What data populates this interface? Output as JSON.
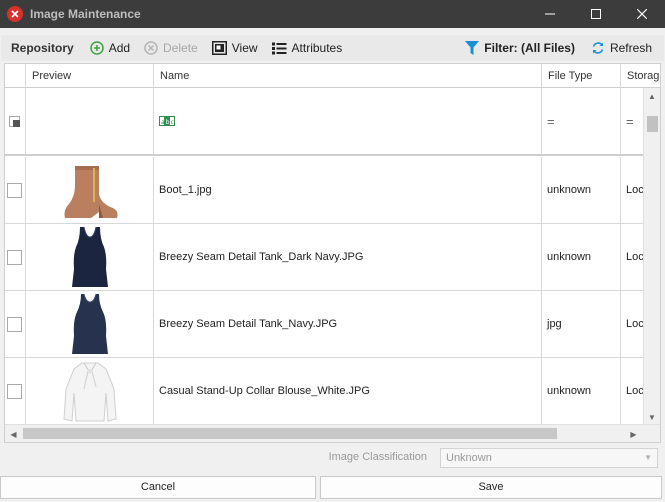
{
  "window": {
    "title": "Image Maintenance"
  },
  "toolbar": {
    "group_label": "Repository",
    "add_label": "Add",
    "delete_label": "Delete",
    "view_label": "View",
    "attributes_label": "Attributes",
    "filter_label": "Filter: (All Files)",
    "refresh_label": "Refresh"
  },
  "grid": {
    "columns": [
      "Preview",
      "Name",
      "File Type",
      "Storage"
    ],
    "filter_row": {
      "name_icon": "abc-text-filter-icon",
      "file_type_op": "=",
      "storage_op": "="
    },
    "rows": [
      {
        "name": "Boot_1.jpg",
        "file_type": "unknown",
        "storage": "Loc",
        "thumb": "boot-image"
      },
      {
        "name": "Breezy Seam Detail Tank_Dark Navy.JPG",
        "file_type": "unknown",
        "storage": "Loc",
        "thumb": "tank-top-image"
      },
      {
        "name": "Breezy Seam Detail Tank_Navy.JPG",
        "file_type": "jpg",
        "storage": "Loc",
        "thumb": "tank-top-image"
      },
      {
        "name": "Casual Stand-Up Collar Blouse_White.JPG",
        "file_type": "unknown",
        "storage": "Loc",
        "thumb": "blouse-image"
      }
    ]
  },
  "classification": {
    "label": "Image Classification",
    "value": "Unknown"
  },
  "footer": {
    "cancel_label": "Cancel",
    "save_label": "Save"
  },
  "colors": {
    "titlebar": "#3c3c3c",
    "accent": "#1a8fd6",
    "add_green": "#3fa23f"
  }
}
